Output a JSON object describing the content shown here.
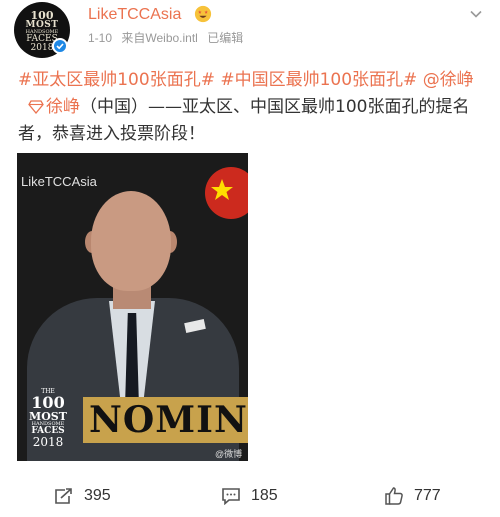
{
  "author": {
    "name": "LikeTCCAsia",
    "emoji_icon": "star-struck-face-icon",
    "avatar": {
      "line1": "100",
      "line2": "MOST",
      "line3": "HANDSOME",
      "line4": "FACES",
      "line5": "2018"
    },
    "verified_icon": "verified-check-icon"
  },
  "meta": {
    "date": "1-10",
    "source": "来自Weibo.intl",
    "edited": "已编辑"
  },
  "post": {
    "tag1": "#亚太区最帅100张面孔#",
    "tag2": "#中国区最帅100张面孔#",
    "at_sign": "@",
    "mention": "徐峥",
    "link_icon": "diamond-link-icon",
    "link_text": "徐峥",
    "body": "（中国）——亚太区、中国区最帅100张面孔的提名者，恭喜进入投票阶段！"
  },
  "image": {
    "watermark": "LikeTCCAsia",
    "badge": {
      "a": "THE",
      "b": "100",
      "c": "MOST",
      "d": "HANDSOME",
      "e": "FACES",
      "f": "2018"
    },
    "nominee": "NOMINE",
    "credit": "@微博 @Li..."
  },
  "actions": {
    "repost_count": "395",
    "comment_count": "185",
    "like_count": "777"
  },
  "colors": {
    "accent": "#eb7350",
    "meta": "#999999",
    "gold": "#c8a24c"
  }
}
